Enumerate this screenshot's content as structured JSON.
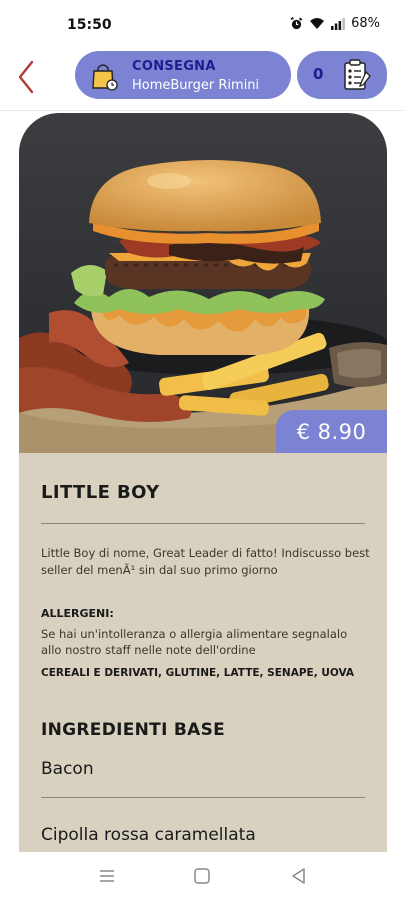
{
  "status": {
    "time": "15:50",
    "battery": "68%"
  },
  "header": {
    "delivery_title": "CONSEGNA",
    "store_name": "HomeBurger Rimini",
    "cart_count": "0"
  },
  "product": {
    "price": "€ 8.90",
    "name": "LITTLE BOY",
    "description": "Little Boy di nome, Great Leader di fatto! Indiscusso best seller del menÃ¹ sin dal suo primo giorno",
    "allergens_heading": "ALLERGENI:",
    "allergens_note": "Se hai un'intolleranza o allergia alimentare segnalalo allo nostro staff nelle note dell'ordine",
    "allergens_list": "CEREALI E DERIVATI, GLUTINE, LATTE, SENAPE, UOVA",
    "ingredients_heading": "INGREDIENTI BASE",
    "ingredients": [
      "Bacon",
      "Cipolla rossa caramellata"
    ]
  },
  "colors": {
    "accent": "#7c83d2",
    "accent_text": "#1f1c8f",
    "card_bg": "#d8d1c0",
    "back_arrow": "#b03a3a"
  },
  "icons": [
    "alarm-icon",
    "wifi-icon",
    "signal-icon",
    "battery-icon",
    "back-arrow-icon",
    "shopping-bag-icon",
    "order-list-icon",
    "recent-apps-icon",
    "home-icon",
    "back-nav-icon"
  ]
}
